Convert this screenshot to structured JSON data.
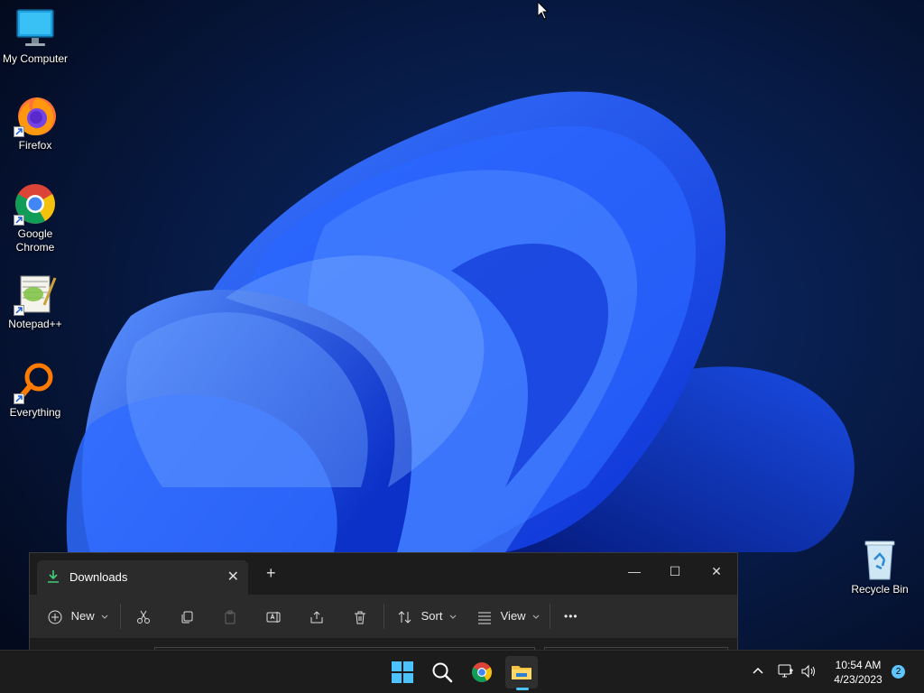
{
  "desktop": {
    "icons": [
      {
        "label": "My Computer",
        "icon": "monitor-icon"
      },
      {
        "label": "Firefox",
        "icon": "firefox-icon"
      },
      {
        "label": "Google Chrome",
        "icon": "chrome-icon"
      },
      {
        "label": "Notepad++",
        "icon": "notepadpp-icon"
      },
      {
        "label": "Everything",
        "icon": "everything-icon"
      },
      {
        "label": "Recycle Bin",
        "icon": "recycle-bin-icon"
      }
    ]
  },
  "explorer": {
    "tab_title": "Downloads",
    "toolbar": {
      "new_label": "New",
      "sort_label": "Sort",
      "view_label": "View",
      "more_label": "•••"
    },
    "window_buttons": {
      "minimize": "—",
      "maximize": "☐",
      "close": "✕"
    }
  },
  "taskbar": {
    "pinned": [
      "start-icon",
      "search-icon",
      "chrome-icon",
      "file-explorer-icon"
    ],
    "clock": {
      "time": "10:54 AM",
      "date": "4/23/2023"
    },
    "notification_count": "2"
  },
  "colors": {
    "accent": "#4cc2ff",
    "taskbar_bg": "#1c1c1c",
    "window_bg": "#202020",
    "wallpaper_blue": "#1a4dff"
  }
}
